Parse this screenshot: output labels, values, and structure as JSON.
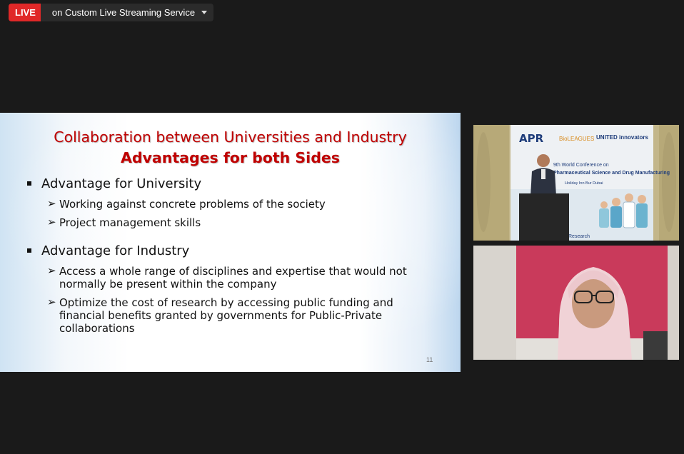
{
  "live_bar": {
    "badge": "LIVE",
    "text": "on Custom Live Streaming Service"
  },
  "slide": {
    "title_line1": "Collaboration between Universities and Industry",
    "title_line2": "Advantages for both Sides",
    "sections": [
      {
        "heading": "Advantage for University",
        "items": [
          "Working against concrete problems of the society",
          "Project management skills"
        ]
      },
      {
        "heading": "Advantage for Industry",
        "items": [
          [
            "Access a whole range of disciplines and expertise that would not",
            "normally be present within the company"
          ],
          [
            "Optimize the cost of research by accessing public funding and",
            "financial benefits granted by governments for Public-Private",
            "collaborations"
          ]
        ]
      }
    ],
    "page_number": "11"
  },
  "video_tiles": {
    "speaker_banner": {
      "logo": "APR",
      "sponsors": [
        "BioLEAGUES",
        "UNITED innovators"
      ],
      "line1": "9th World Conference on",
      "line2": "Pharmaceutical Science and Drug Manufacturing",
      "venue": "Holiday Inn Bur Dubai",
      "corner": "Research"
    }
  }
}
